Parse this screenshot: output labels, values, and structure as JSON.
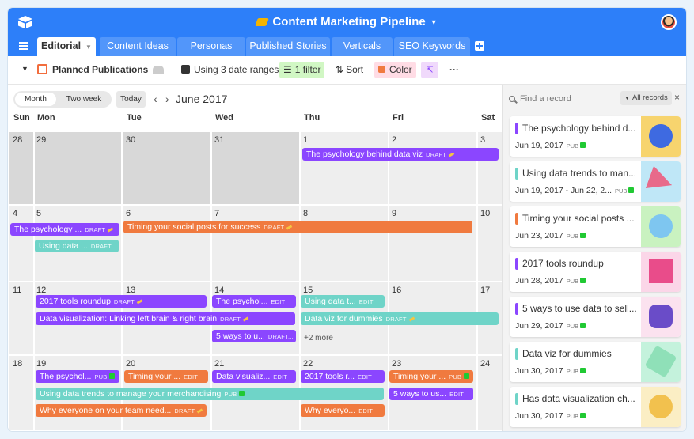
{
  "app": {
    "title": "Content Marketing Pipeline"
  },
  "tabs": [
    "Editorial",
    "Content Ideas",
    "Personas",
    "Published Stories",
    "Verticals",
    "SEO Keywords"
  ],
  "toolbar": {
    "view_name": "Planned Publications",
    "date_ranges": "Using 3 date ranges",
    "filter": "1 filter",
    "sort": "Sort",
    "color": "Color",
    "more": "···"
  },
  "calendar": {
    "mode_month": "Month",
    "mode_two_week": "Two week",
    "today": "Today",
    "month_label": "June 2017",
    "days": [
      "Sun",
      "Mon",
      "Tue",
      "Wed",
      "Thu",
      "Fri",
      "Sat"
    ],
    "dates": [
      [
        "28",
        "29",
        "30",
        "31",
        "1",
        "2",
        "3"
      ],
      [
        "4",
        "5",
        "6",
        "7",
        "8",
        "9",
        "10"
      ],
      [
        "11",
        "12",
        "13",
        "14",
        "15",
        "16",
        "17"
      ],
      [
        "18",
        "19",
        "20",
        "21",
        "22",
        "23",
        "24"
      ]
    ],
    "more_label": "+2 more"
  },
  "events": [
    {
      "title": "The psychology behind data viz",
      "status": "DRAFT",
      "color": "purple",
      "mark": "pen"
    },
    {
      "title": "The psychology ...",
      "status": "DRAFT",
      "color": "purple",
      "mark": "pen"
    },
    {
      "title": "Timing your social posts for success",
      "status": "DRAFT",
      "color": "orange",
      "mark": "pen"
    },
    {
      "title": "Using data ...",
      "status": "DRAFT...",
      "color": "teal",
      "mark": ""
    },
    {
      "title": "2017 tools roundup",
      "status": "DRAFT",
      "color": "purple",
      "mark": "pen"
    },
    {
      "title": "The psychol...",
      "status": "EDIT",
      "color": "purple",
      "mark": ""
    },
    {
      "title": "Using data t...",
      "status": "EDIT",
      "color": "teal",
      "mark": ""
    },
    {
      "title": "Data visualization: Linking left brain & right brain",
      "status": "DRAFT",
      "color": "purple",
      "mark": "pen"
    },
    {
      "title": "Data viz for dummies",
      "status": "DRAFT",
      "color": "teal",
      "mark": "pen"
    },
    {
      "title": "5 ways to u...",
      "status": "DRAFT...",
      "color": "purple",
      "mark": ""
    },
    {
      "title": "The psychol...",
      "status": "PUB",
      "color": "purple",
      "mark": "chk"
    },
    {
      "title": "Timing your ...",
      "status": "EDIT",
      "color": "orange",
      "mark": ""
    },
    {
      "title": "Data visualiz...",
      "status": "EDIT",
      "color": "purple",
      "mark": ""
    },
    {
      "title": "2017 tools r...",
      "status": "EDIT",
      "color": "purple",
      "mark": ""
    },
    {
      "title": "Timing your ...",
      "status": "PUB",
      "color": "orange",
      "mark": "chk"
    },
    {
      "title": "Using data trends to manage your merchandising",
      "status": "PUB",
      "color": "teal",
      "mark": "chk"
    },
    {
      "title": "5 ways to us...",
      "status": "EDIT",
      "color": "purple",
      "mark": ""
    },
    {
      "title": "Why everyone on your team need...",
      "status": "DRAFT",
      "color": "orange",
      "mark": "pen"
    },
    {
      "title": "Why everyo...",
      "status": "EDIT",
      "color": "orange",
      "mark": ""
    }
  ],
  "sidebar": {
    "search_placeholder": "Find a record",
    "all_records": "All records",
    "close": "×",
    "cards": [
      {
        "title": "The psychology behind d...",
        "date": "Jun 19, 2017",
        "status": "PUB",
        "color": "#8b46ff",
        "thumb_bg": "#f7d46e"
      },
      {
        "title": "Using data trends to man...",
        "date": "Jun 19, 2017 - Jun 22, 2...",
        "status": "PUB",
        "color": "#6fd4c8",
        "thumb_bg": "#bfe7f7"
      },
      {
        "title": "Timing your social posts ...",
        "date": "Jun 23, 2017",
        "status": "PUB",
        "color": "#f07a3f",
        "thumb_bg": "#c9f2c0"
      },
      {
        "title": "2017 tools roundup",
        "date": "Jun 28, 2017",
        "status": "PUB",
        "color": "#8b46ff",
        "thumb_bg": "#fbd6e8"
      },
      {
        "title": "5 ways to use data to sell...",
        "date": "Jun 29, 2017",
        "status": "PUB",
        "color": "#8b46ff",
        "thumb_bg": "#fbe2ef"
      },
      {
        "title": "Data viz for dummies",
        "date": "Jun 30, 2017",
        "status": "PUB",
        "color": "#6fd4c8",
        "thumb_bg": "#c4f2dc"
      },
      {
        "title": "Has data visualization ch...",
        "date": "Jun 30, 2017",
        "status": "PUB",
        "color": "#6fd4c8",
        "thumb_bg": "#fbeec4"
      }
    ]
  },
  "colors": {
    "brand": "#2d7ff9",
    "purple": "#8b46ff",
    "orange": "#f07a3f",
    "teal": "#6fd4c8"
  }
}
